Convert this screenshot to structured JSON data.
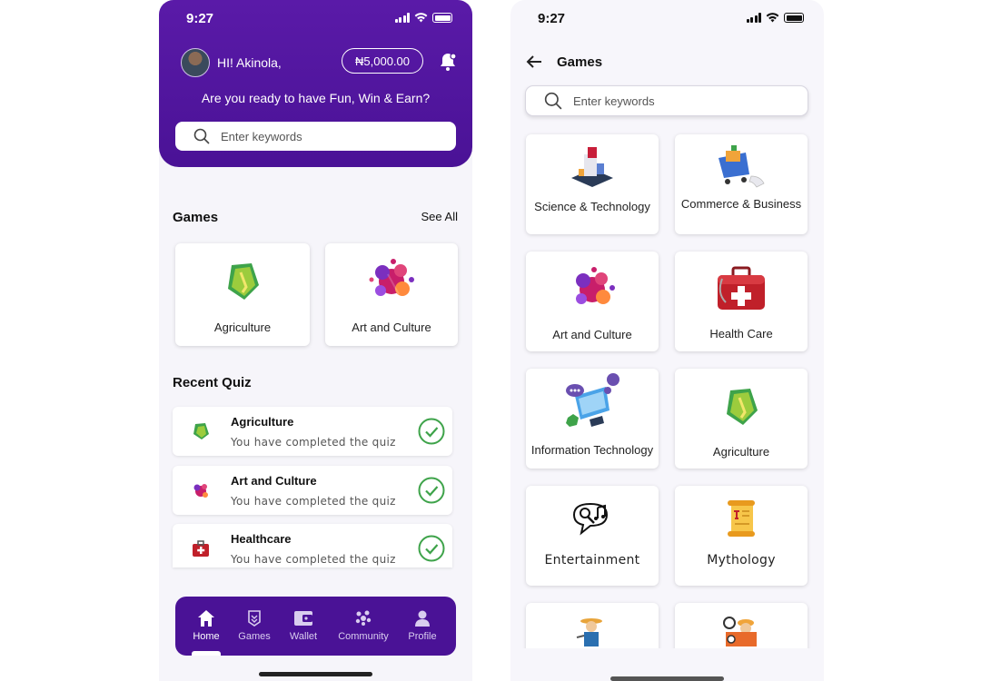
{
  "home": {
    "status_time": "9:27",
    "greeting": "HI! Akinola,",
    "balance": "₦5,000.00",
    "tagline": "Are you ready to have Fun, Win & Earn?",
    "search_placeholder": "Enter keywords",
    "games_title": "Games",
    "see_all": "See All",
    "games": [
      {
        "label": "Agriculture",
        "icon": "leaf-icon"
      },
      {
        "label": "Art and Culture",
        "icon": "art-splash-icon"
      }
    ],
    "recent_title": "Recent Quiz",
    "recent": [
      {
        "title": "Agriculture",
        "status": "You have completed the quiz",
        "icon": "leaf-icon"
      },
      {
        "title": "Art and Culture",
        "status": "You have completed the quiz",
        "icon": "art-splash-icon"
      },
      {
        "title": "Healthcare",
        "status": "You have completed the quiz",
        "icon": "medical-kit-icon"
      }
    ],
    "nav": [
      {
        "label": "Home",
        "icon": "home-icon",
        "active": true
      },
      {
        "label": "Games",
        "icon": "games-icon"
      },
      {
        "label": "Wallet",
        "icon": "wallet-icon"
      },
      {
        "label": "Community",
        "icon": "community-icon"
      },
      {
        "label": "Profile",
        "icon": "profile-icon"
      }
    ]
  },
  "games_page": {
    "status_time": "9:27",
    "title": "Games",
    "search_placeholder": "Enter keywords",
    "items": [
      {
        "label": "Science & Technology",
        "icon": "lab-icon"
      },
      {
        "label": "Commerce & Business",
        "icon": "shopping-cart-icon"
      },
      {
        "label": "Art and Culture",
        "icon": "art-splash-icon"
      },
      {
        "label": "Health Care",
        "icon": "medical-kit-icon"
      },
      {
        "label": "Information Technology",
        "icon": "computer-icon"
      },
      {
        "label": "Agriculture",
        "icon": "leaf-icon"
      },
      {
        "label": "Entertainment",
        "icon": "microphone-music-icon"
      },
      {
        "label": "Mythology",
        "icon": "scroll-icon"
      },
      {
        "label": "",
        "icon": "farmer-icon"
      },
      {
        "label": "",
        "icon": "engineer-icon"
      }
    ]
  },
  "colors": {
    "primary": "#4a1296",
    "accent_green": "#3ea34a",
    "background": "#f6f5fa"
  }
}
